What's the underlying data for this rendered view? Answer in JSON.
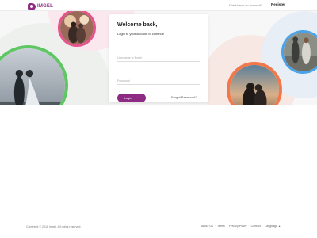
{
  "brand": {
    "name": "IMGEL",
    "color": "#8e2c84"
  },
  "header": {
    "prompt": "Don't have an account?",
    "register_label": "Register"
  },
  "login": {
    "title": "Welcome back,",
    "subtitle": "Login to your account to continue",
    "username_placeholder": "Username or Email",
    "password_placeholder": "Password",
    "login_label": "Login",
    "forgot_label": "Forgot Password?"
  },
  "photos": [
    {
      "name": "couple-photo-top",
      "ring_color": "#e6538c"
    },
    {
      "name": "couple-photo-left",
      "ring_color": "#5ec763"
    },
    {
      "name": "couple-photo-bottom-right",
      "ring_color": "#f0784a"
    },
    {
      "name": "couple-photo-right",
      "ring_color": "#4aa3e8"
    }
  ],
  "footer": {
    "copyright": "Copyright © 2018 Imgel. All rights reserved.",
    "links": [
      "About Us",
      "Terms",
      "Privacy Policy",
      "Contact",
      "Language"
    ]
  }
}
